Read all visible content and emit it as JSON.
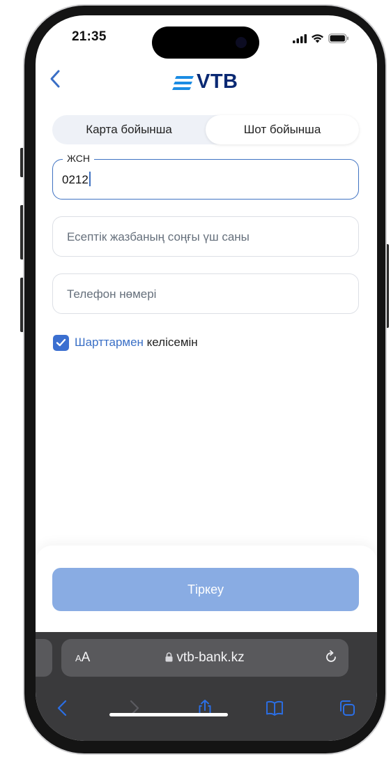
{
  "status_bar": {
    "time": "21:35"
  },
  "header": {
    "logo_text": "VTB"
  },
  "segmented": {
    "left_label": "Карта бойынша",
    "right_label": "Шот бойынша"
  },
  "form": {
    "iin": {
      "label": "ЖСН",
      "value": "0212"
    },
    "account_digits": {
      "placeholder": "Есептік жазбаның соңғы үш саны"
    },
    "phone": {
      "placeholder": "Телефон нөмері"
    },
    "agreement": {
      "link_text": "Шарттармен",
      "text": " келісемін",
      "checked": true
    }
  },
  "submit": {
    "label": "Тіркеу"
  },
  "safari": {
    "aa_label_small": "A",
    "aa_label_big": "A",
    "url": "vtb-bank.kz"
  },
  "colors": {
    "accent": "#3b6fd0",
    "brand_navy": "#0a2973",
    "cta_disabled": "#89ace3"
  }
}
